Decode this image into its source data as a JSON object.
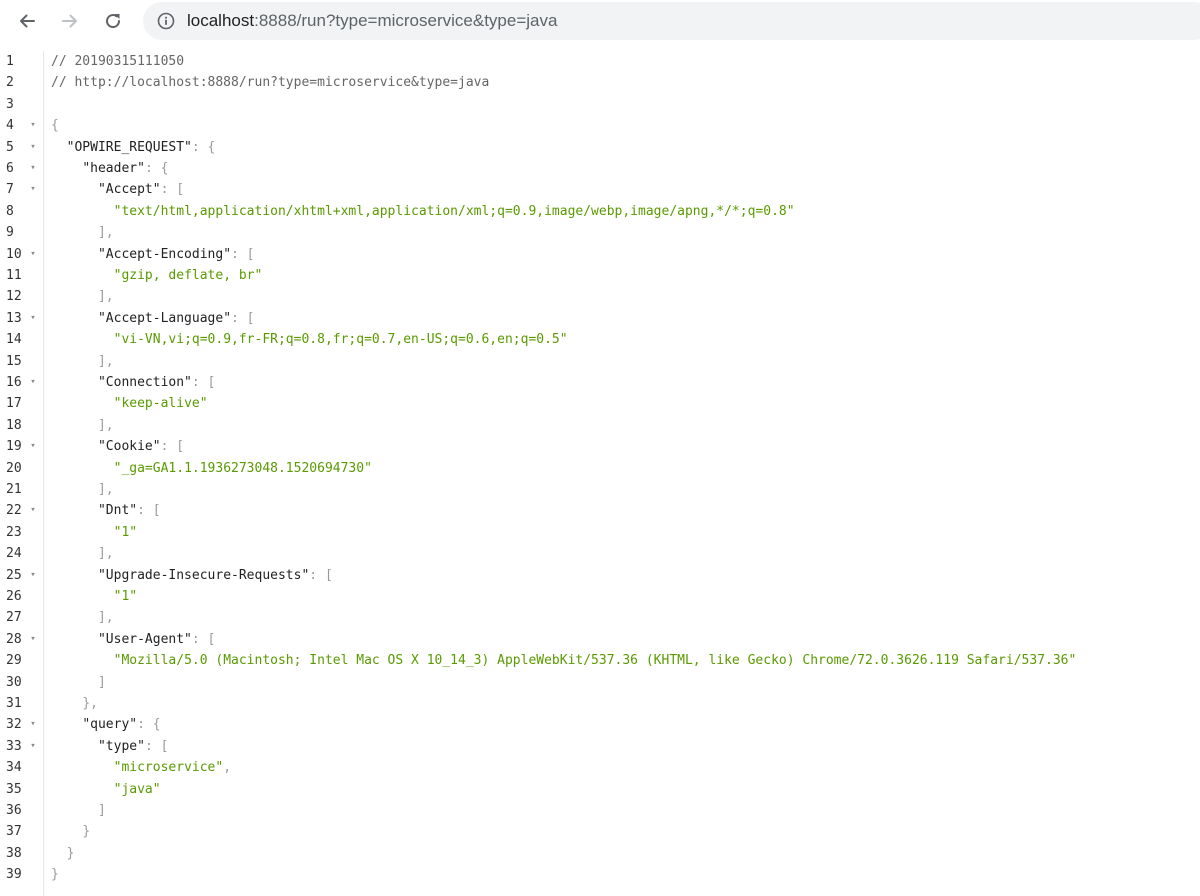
{
  "browser": {
    "back_icon": "arrow-left-icon",
    "forward_icon": "arrow-right-icon",
    "reload_icon": "reload-icon",
    "info_icon": "info-circle-icon",
    "url_host": "localhost",
    "url_rest": ":8888/run?type=microservice&type=java"
  },
  "code": {
    "lines": [
      {
        "n": "1",
        "fold": "",
        "indent": "",
        "parts": [
          {
            "t": "// 20190315111050",
            "c": "comment"
          }
        ]
      },
      {
        "n": "2",
        "fold": "",
        "indent": "",
        "parts": [
          {
            "t": "// http://localhost:8888/run?type=microservice&type=java",
            "c": "comment"
          }
        ]
      },
      {
        "n": "3",
        "fold": "",
        "indent": "",
        "parts": []
      },
      {
        "n": "4",
        "fold": "▾",
        "indent": "",
        "parts": [
          {
            "t": "{",
            "c": "punc"
          }
        ]
      },
      {
        "n": "5",
        "fold": "▾",
        "indent": "  ",
        "parts": [
          {
            "t": "\"OPWIRE_REQUEST\"",
            "c": "key"
          },
          {
            "t": ": {",
            "c": "punc"
          }
        ]
      },
      {
        "n": "6",
        "fold": "▾",
        "indent": "    ",
        "parts": [
          {
            "t": "\"header\"",
            "c": "key"
          },
          {
            "t": ": {",
            "c": "punc"
          }
        ]
      },
      {
        "n": "7",
        "fold": "▾",
        "indent": "      ",
        "parts": [
          {
            "t": "\"Accept\"",
            "c": "key"
          },
          {
            "t": ": [",
            "c": "punc"
          }
        ]
      },
      {
        "n": "8",
        "fold": "",
        "indent": "        ",
        "parts": [
          {
            "t": "\"text/html,application/xhtml+xml,application/xml;q=0.9,image/webp,image/apng,*/*;q=0.8\"",
            "c": "str"
          }
        ]
      },
      {
        "n": "9",
        "fold": "",
        "indent": "      ",
        "parts": [
          {
            "t": "],",
            "c": "punc"
          }
        ]
      },
      {
        "n": "10",
        "fold": "▾",
        "indent": "      ",
        "parts": [
          {
            "t": "\"Accept-Encoding\"",
            "c": "key"
          },
          {
            "t": ": [",
            "c": "punc"
          }
        ]
      },
      {
        "n": "11",
        "fold": "",
        "indent": "        ",
        "parts": [
          {
            "t": "\"gzip, deflate, br\"",
            "c": "str"
          }
        ]
      },
      {
        "n": "12",
        "fold": "",
        "indent": "      ",
        "parts": [
          {
            "t": "],",
            "c": "punc"
          }
        ]
      },
      {
        "n": "13",
        "fold": "▾",
        "indent": "      ",
        "parts": [
          {
            "t": "\"Accept-Language\"",
            "c": "key"
          },
          {
            "t": ": [",
            "c": "punc"
          }
        ]
      },
      {
        "n": "14",
        "fold": "",
        "indent": "        ",
        "parts": [
          {
            "t": "\"vi-VN,vi;q=0.9,fr-FR;q=0.8,fr;q=0.7,en-US;q=0.6,en;q=0.5\"",
            "c": "str"
          }
        ]
      },
      {
        "n": "15",
        "fold": "",
        "indent": "      ",
        "parts": [
          {
            "t": "],",
            "c": "punc"
          }
        ]
      },
      {
        "n": "16",
        "fold": "▾",
        "indent": "      ",
        "parts": [
          {
            "t": "\"Connection\"",
            "c": "key"
          },
          {
            "t": ": [",
            "c": "punc"
          }
        ]
      },
      {
        "n": "17",
        "fold": "",
        "indent": "        ",
        "parts": [
          {
            "t": "\"keep-alive\"",
            "c": "str"
          }
        ]
      },
      {
        "n": "18",
        "fold": "",
        "indent": "      ",
        "parts": [
          {
            "t": "],",
            "c": "punc"
          }
        ]
      },
      {
        "n": "19",
        "fold": "▾",
        "indent": "      ",
        "parts": [
          {
            "t": "\"Cookie\"",
            "c": "key"
          },
          {
            "t": ": [",
            "c": "punc"
          }
        ]
      },
      {
        "n": "20",
        "fold": "",
        "indent": "        ",
        "parts": [
          {
            "t": "\"_ga=GA1.1.1936273048.1520694730\"",
            "c": "str"
          }
        ]
      },
      {
        "n": "21",
        "fold": "",
        "indent": "      ",
        "parts": [
          {
            "t": "],",
            "c": "punc"
          }
        ]
      },
      {
        "n": "22",
        "fold": "▾",
        "indent": "      ",
        "parts": [
          {
            "t": "\"Dnt\"",
            "c": "key"
          },
          {
            "t": ": [",
            "c": "punc"
          }
        ]
      },
      {
        "n": "23",
        "fold": "",
        "indent": "        ",
        "parts": [
          {
            "t": "\"1\"",
            "c": "str"
          }
        ]
      },
      {
        "n": "24",
        "fold": "",
        "indent": "      ",
        "parts": [
          {
            "t": "],",
            "c": "punc"
          }
        ]
      },
      {
        "n": "25",
        "fold": "▾",
        "indent": "      ",
        "parts": [
          {
            "t": "\"Upgrade-Insecure-Requests\"",
            "c": "key"
          },
          {
            "t": ": [",
            "c": "punc"
          }
        ]
      },
      {
        "n": "26",
        "fold": "",
        "indent": "        ",
        "parts": [
          {
            "t": "\"1\"",
            "c": "str"
          }
        ]
      },
      {
        "n": "27",
        "fold": "",
        "indent": "      ",
        "parts": [
          {
            "t": "],",
            "c": "punc"
          }
        ]
      },
      {
        "n": "28",
        "fold": "▾",
        "indent": "      ",
        "parts": [
          {
            "t": "\"User-Agent\"",
            "c": "key"
          },
          {
            "t": ": [",
            "c": "punc"
          }
        ]
      },
      {
        "n": "29",
        "fold": "",
        "indent": "        ",
        "parts": [
          {
            "t": "\"Mozilla/5.0 (Macintosh; Intel Mac OS X 10_14_3) AppleWebKit/537.36 (KHTML, like Gecko) Chrome/72.0.3626.119 Safari/537.36\"",
            "c": "str"
          }
        ]
      },
      {
        "n": "30",
        "fold": "",
        "indent": "      ",
        "parts": [
          {
            "t": "]",
            "c": "punc"
          }
        ]
      },
      {
        "n": "31",
        "fold": "",
        "indent": "    ",
        "parts": [
          {
            "t": "},",
            "c": "punc"
          }
        ]
      },
      {
        "n": "32",
        "fold": "▾",
        "indent": "    ",
        "parts": [
          {
            "t": "\"query\"",
            "c": "key"
          },
          {
            "t": ": {",
            "c": "punc"
          }
        ]
      },
      {
        "n": "33",
        "fold": "▾",
        "indent": "      ",
        "parts": [
          {
            "t": "\"type\"",
            "c": "key"
          },
          {
            "t": ": [",
            "c": "punc"
          }
        ]
      },
      {
        "n": "34",
        "fold": "",
        "indent": "        ",
        "parts": [
          {
            "t": "\"microservice\"",
            "c": "str"
          },
          {
            "t": ",",
            "c": "punc"
          }
        ]
      },
      {
        "n": "35",
        "fold": "",
        "indent": "        ",
        "parts": [
          {
            "t": "\"java\"",
            "c": "str"
          }
        ]
      },
      {
        "n": "36",
        "fold": "",
        "indent": "      ",
        "parts": [
          {
            "t": "]",
            "c": "punc"
          }
        ]
      },
      {
        "n": "37",
        "fold": "",
        "indent": "    ",
        "parts": [
          {
            "t": "}",
            "c": "punc"
          }
        ]
      },
      {
        "n": "38",
        "fold": "",
        "indent": "  ",
        "parts": [
          {
            "t": "}",
            "c": "punc"
          }
        ]
      },
      {
        "n": "39",
        "fold": "",
        "indent": "",
        "parts": [
          {
            "t": "}",
            "c": "punc"
          }
        ]
      }
    ]
  }
}
